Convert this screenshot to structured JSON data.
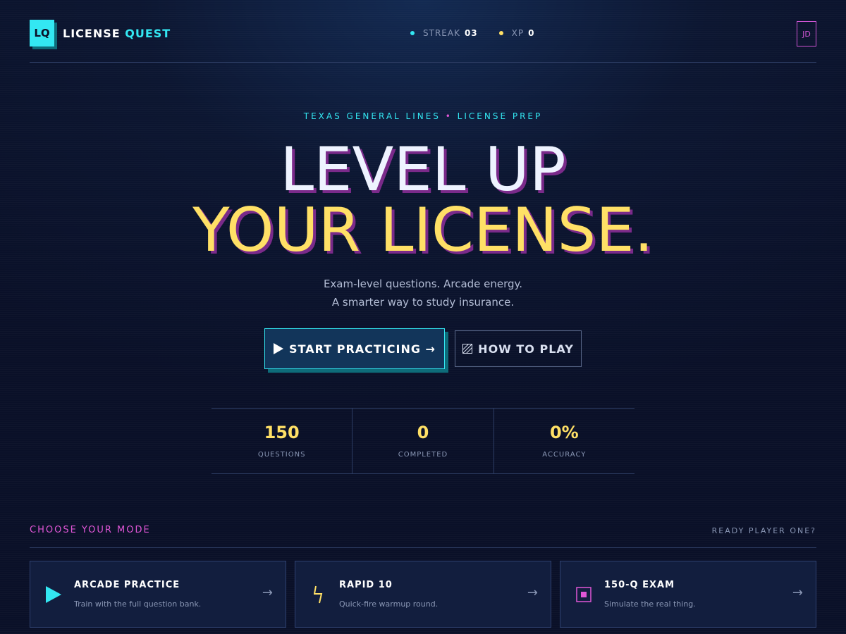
{
  "header": {
    "logo_mark": "LQ",
    "brand_main": "LICENSE",
    "brand_accent": "QUEST",
    "streak_label": "STREAK",
    "streak_value": "03",
    "xp_label": "XP",
    "xp_value": "0",
    "avatar_initials": "JD"
  },
  "hero": {
    "eyebrow_left": "TEXAS GENERAL LINES",
    "eyebrow_sep": "•",
    "eyebrow_right": "LICENSE PREP",
    "title_line1": "LEVEL UP",
    "title_line2": "YOUR LICENSE.",
    "subtitle_line1": "Exam-level questions. Arcade energy.",
    "subtitle_line2": "A smarter way to study insurance.",
    "primary_button": "START PRACTICING →",
    "secondary_button": "HOW TO PLAY"
  },
  "stats": [
    {
      "value": "150",
      "label": "QUESTIONS"
    },
    {
      "value": "0",
      "label": "COMPLETED"
    },
    {
      "value": "0%",
      "label": "ACCURACY"
    }
  ],
  "modes": {
    "title": "CHOOSE YOUR MODE",
    "right_label": "READY PLAYER ONE?",
    "cards": [
      {
        "title": "ARCADE PRACTICE",
        "desc": "Train with the full question bank.",
        "icon": "play-icon"
      },
      {
        "title": "RAPID 10",
        "desc": "Quick-fire warmup round.",
        "icon": "lightning-icon"
      },
      {
        "title": "150-Q EXAM",
        "desc": "Simulate the real thing.",
        "icon": "square-target-icon"
      }
    ]
  },
  "colors": {
    "accent_cyan": "#33e7f2",
    "accent_yellow": "#ffe066",
    "accent_magenta": "#e056d6",
    "background": "#0c1631"
  }
}
